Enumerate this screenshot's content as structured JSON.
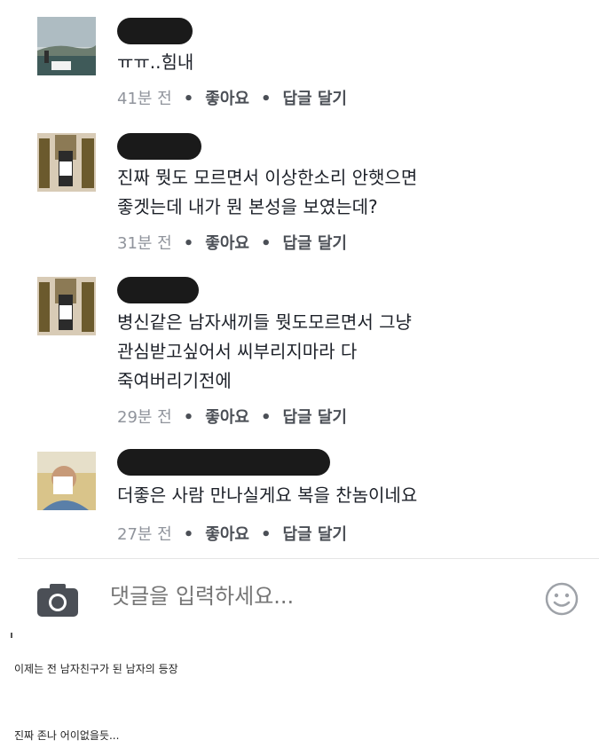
{
  "comments": [
    {
      "text_lines": [
        "ㅠㅠ..힘내"
      ],
      "time": "41분 전",
      "like": "좋아요",
      "reply": "답글 달기"
    },
    {
      "text_lines": [
        "진짜 뭣도 모르면서 이상한소리 안햇으면",
        "좋겟는데 내가 뭔 본성을 보였는데?"
      ],
      "time": "31분 전",
      "like": "좋아요",
      "reply": "답글 달기"
    },
    {
      "text_lines": [
        "병신같은 남자새끼들 뭣도모르면서 그냥",
        "관심받고싶어서 씨부리지마라 다",
        "죽여버리기전에"
      ],
      "time": "29분 전",
      "like": "좋아요",
      "reply": "답글 달기"
    },
    {
      "text_lines": [
        "더좋은 사람 만나실게요 복을 찬놈이네요"
      ],
      "time": "27분 전",
      "like": "좋아요",
      "reply": "답글 달기"
    }
  ],
  "composer": {
    "placeholder": "댓글을 입력하세요..."
  },
  "captions": {
    "line1": "이제는 전 남자친구가 된 남자의 등장",
    "line2": "진짜 존나 어이없을듯..."
  },
  "icons": {
    "camera": "camera-icon",
    "emoji": "smiley-icon"
  },
  "colors": {
    "meta_text": "#90949c",
    "link_text": "#4b4f56",
    "body_text": "#1d2129"
  }
}
